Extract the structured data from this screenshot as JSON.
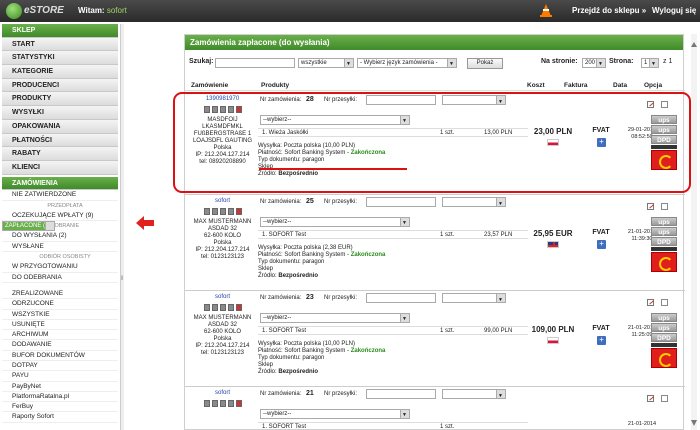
{
  "topbar": {
    "logo_text": "eSTORE",
    "welcome_label": "Witam:",
    "welcome_user": "sofort",
    "shop_link": "Przejdź do sklepu »",
    "logout_link": "Wyloguj się"
  },
  "sidebar": {
    "top_items": [
      "SKLEP",
      "START",
      "STATYSTYKI",
      "KATEGORIE",
      "PRODUCENCI",
      "PRODUKTY",
      "WYSYŁKI",
      "OPAKOWANIA",
      "PŁATNOŚCI",
      "RABATY",
      "KLIENCI"
    ],
    "orders_section": "ZAMÓWIENIA",
    "sub1": [
      "NIE ZATWIERDZONE"
    ],
    "hdr_prepaid": "PRZEDPŁATA",
    "sub2": [
      "OCZEKUJĄCE WPŁATY (9)",
      "ZAPŁACONE (10)"
    ],
    "hdr_cod": "POBRANIE",
    "sub3": [
      "DO WYSŁANIA (2)",
      "WYSŁANE"
    ],
    "hdr_pickup": "ODBIÓR OSOBISTY",
    "sub4": [
      "W PRZYGOTOWANIU",
      "DO ODEBRANIA"
    ],
    "sub5": [
      "ZREALIZOWANE",
      "ODRZUCONE",
      "WSZYSTKIE",
      "USUNIĘTE",
      "ARCHIWUM",
      "DODAWANIE",
      "BUFOR DOKUMENTÓW",
      "DOTPAY",
      "PAYU",
      "PayByNet",
      "PlatformaRatalna.pl",
      "FerBuy",
      "Raporty Sofort"
    ]
  },
  "panel": {
    "title": "Zamówienia zapłacone (do wysłania)",
    "search_label": "Szukaj:",
    "scope_select": "wszystkie",
    "lang_select": "- Wybierz język zamówienia -",
    "show_button": "Pokaż",
    "per_page_label": "Na stronie:",
    "per_page_value": "200",
    "page_label": "Strona:",
    "page_value": "1",
    "page_total": "z 1",
    "columns": [
      "Zamówienie",
      "Produkty",
      "Koszt",
      "Faktura",
      "Data",
      "Opcja"
    ]
  },
  "orders": [
    {
      "id": "1390981970",
      "order_label": "Nr zamówienia:",
      "order_no": "28",
      "shipment_label": "Nr przesyłki:",
      "status_select": "--wybierz--",
      "cust_lines": [
        "MASDFOIJ",
        "LKASMDFMKL",
        "FUßBERGSTRAßE 1",
        "LOAJSDFL GAUTING",
        "Polska",
        "IP: 212.204.127.214",
        "tel: 08920208890"
      ],
      "product": "1. Wieża Jaskółki",
      "qty": "1 szt.",
      "unit_price": "13,00 PLN",
      "shipping": "Wysyłka: Poczta polska (10,00 PLN)",
      "payment_prefix": "Płatność: Sofort Banking System -",
      "payment_status": "Zakończona",
      "doc_type": "Typ dokumentu: paragon",
      "doc_place": "Sklep",
      "source_label": "Źródło:",
      "source": "Bezpośrednio",
      "total": "23,00 PLN",
      "invoice": "FVAT",
      "date": "29-01-2014",
      "time": "08:52:50",
      "flag": "pl"
    },
    {
      "id": "sofort",
      "order_label": "Nr zamówienia:",
      "order_no": "25",
      "shipment_label": "Nr przesyłki:",
      "status_select": "--wybierz--",
      "cust_lines": [
        "MAX MUSTERMANN",
        "ASDAD 32",
        "62-600 KOLO",
        "Polska",
        "IP: 212.204.127.214",
        "tel: 0123123123"
      ],
      "product": "1. SOFORT Test",
      "qty": "1 szt.",
      "unit_price": "23,57 PLN",
      "shipping": "Wysyłka: Poczta polska (2,38 EUR)",
      "payment_prefix": "Płatność: Sofort Banking System -",
      "payment_status": "Zakończona",
      "doc_type": "Typ dokumentu: paragon",
      "doc_place": "Sklep",
      "source_label": "Źródło:",
      "source": "Bezpośrednio",
      "total": "25,95 EUR",
      "invoice": "FVAT",
      "date": "21-01-2014",
      "time": "11:39:30",
      "flag": "uk"
    },
    {
      "id": "sofort",
      "order_label": "Nr zamówienia:",
      "order_no": "23",
      "shipment_label": "Nr przesyłki:",
      "status_select": "--wybierz--",
      "cust_lines": [
        "MAX MUSTERMANN",
        "ASDAD 32",
        "62-600 KOLO",
        "Polska",
        "IP: 212.204.127.214",
        "tel: 0123123123"
      ],
      "product": "1. SOFORT Test",
      "qty": "1 szt.",
      "unit_price": "99,00 PLN",
      "shipping": "Wysyłka: Poczta polska (10,00 PLN)",
      "payment_prefix": "Płatność: Sofort Banking System -",
      "payment_status": "Zakończona",
      "doc_type": "Typ dokumentu: paragon",
      "doc_place": "Sklep",
      "source_label": "Źródło:",
      "source": "Bezpośrednio",
      "total": "109,00 PLN",
      "invoice": "FVAT",
      "date": "21-01-2014",
      "time": "11:25:09",
      "flag": "pl"
    },
    {
      "id": "sofort",
      "order_label": "Nr zamówienia:",
      "order_no": "21",
      "shipment_label": "Nr przesyłki:",
      "status_select": "--wybierz--",
      "product": "1. SOFORT Test",
      "qty": "1 szt.",
      "unit_price": "",
      "date": "21-01-2014"
    }
  ],
  "carriers": [
    "ups",
    "ups",
    "DPD"
  ],
  "colors": {
    "accent_green": "#4f9a35",
    "highlight_red": "#dd1111",
    "status_green": "#2a8a1a"
  }
}
